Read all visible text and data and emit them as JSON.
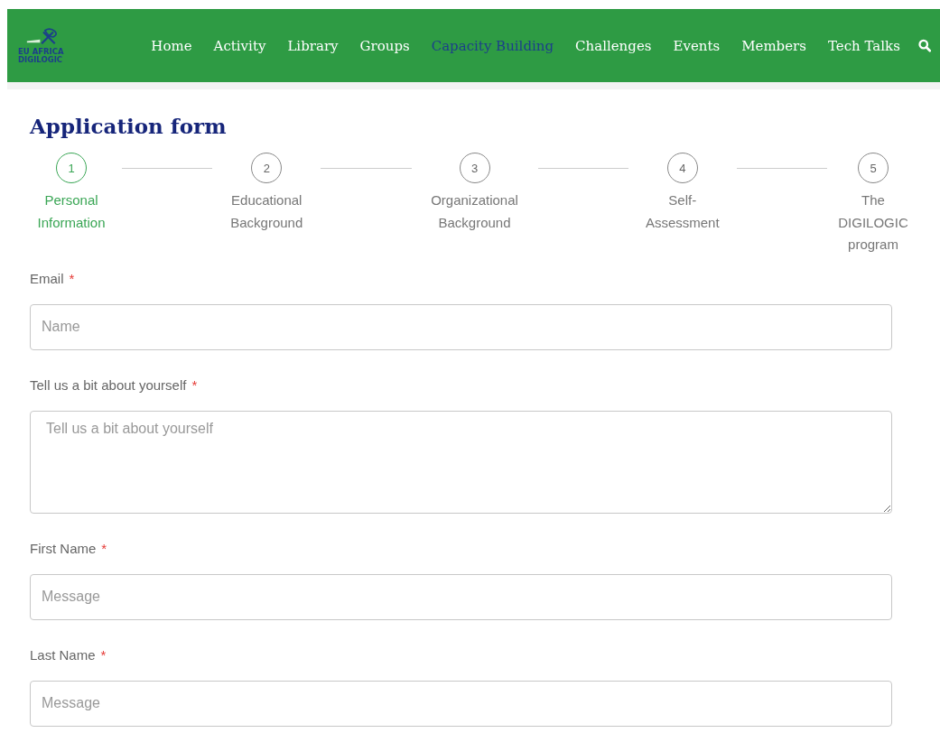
{
  "logo": {
    "lines": [
      "EU AFRICA",
      "DIGILOGIC"
    ]
  },
  "nav": {
    "items": [
      {
        "label": "Home",
        "selected": false
      },
      {
        "label": "Activity",
        "selected": false
      },
      {
        "label": "Library",
        "selected": false
      },
      {
        "label": "Groups",
        "selected": false
      },
      {
        "label": "Capacity Building",
        "selected": true
      },
      {
        "label": "Challenges",
        "selected": false
      },
      {
        "label": "Events",
        "selected": false
      },
      {
        "label": "Members",
        "selected": false
      },
      {
        "label": "Tech Talks",
        "selected": false
      }
    ]
  },
  "title": "Application form",
  "steps": [
    {
      "number": "1",
      "label": "Personal Information",
      "selected": true
    },
    {
      "number": "2",
      "label": "Educational Background",
      "selected": false
    },
    {
      "number": "3",
      "label": "Organizational Background",
      "selected": false
    },
    {
      "number": "4",
      "label": "Self-Assessment",
      "selected": false
    },
    {
      "number": "5",
      "label": "The DIGILOGIC program",
      "selected": false
    }
  ],
  "fields": [
    {
      "kind": "input",
      "label": "Email",
      "required_mark": "*",
      "placeholder": "Name"
    },
    {
      "kind": "textarea",
      "label": "Tell us a bit about yourself",
      "required_mark": "*",
      "placeholder": "Tell us a bit about yourself"
    },
    {
      "kind": "input",
      "label": "First Name",
      "required_mark": "*",
      "placeholder": "Message"
    },
    {
      "kind": "input",
      "label": "Last Name",
      "required_mark": "*",
      "placeholder": "Message"
    }
  ]
}
